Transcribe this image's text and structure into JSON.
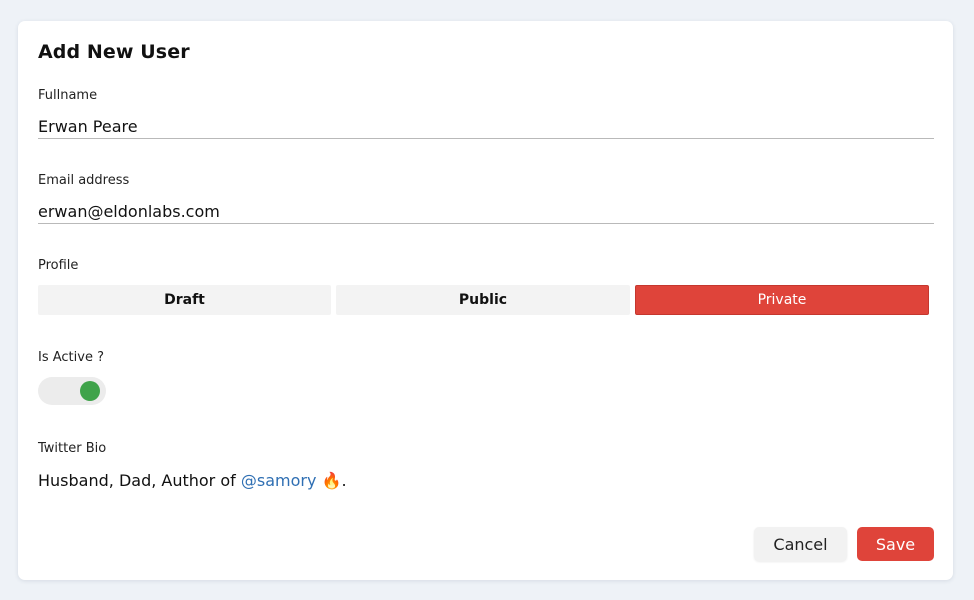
{
  "form": {
    "title": "Add New User",
    "fullname": {
      "label": "Fullname",
      "value": "Erwan Peare"
    },
    "email": {
      "label": "Email address",
      "value": "erwan@eldonlabs.com"
    },
    "profile": {
      "label": "Profile",
      "options": [
        "Draft",
        "Public",
        "Private"
      ],
      "selected": "Private"
    },
    "active": {
      "label": "Is Active ?",
      "on": true
    },
    "bio": {
      "label": "Twitter Bio",
      "prefix": "Husband, Dad, Author of ",
      "mention": "@samory",
      "emoji": "🔥",
      "suffix": "."
    },
    "actions": {
      "cancel": "Cancel",
      "save": "Save"
    }
  },
  "colors": {
    "accent": "#df443a",
    "toggle_on": "#3fa34a",
    "link": "#2f6fb3",
    "background": "#eef2f7"
  }
}
